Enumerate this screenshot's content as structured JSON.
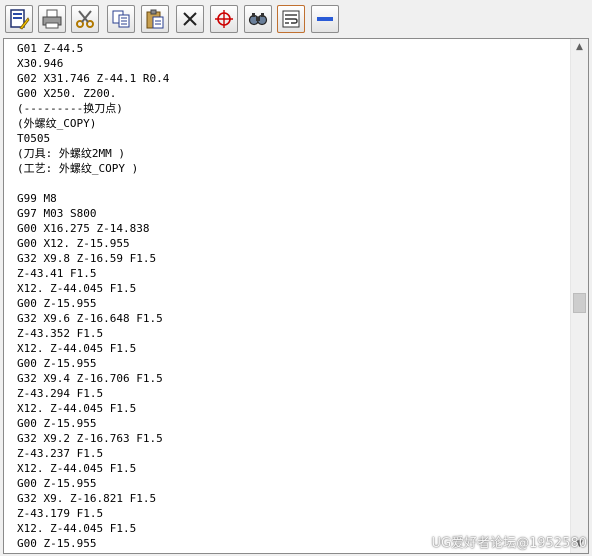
{
  "toolbar": {
    "buttons": [
      {
        "name": "edit-icon"
      },
      {
        "name": "print-icon"
      },
      {
        "name": "cut-icon"
      },
      {
        "name": "copy-icon"
      },
      {
        "name": "paste-icon"
      },
      {
        "name": "delete-icon"
      },
      {
        "name": "target-icon"
      },
      {
        "name": "find-icon"
      },
      {
        "name": "wrap-icon"
      },
      {
        "name": "minus-icon"
      }
    ]
  },
  "editor": {
    "lines": [
      "G01 Z-44.5",
      "X30.946",
      "G02 X31.746 Z-44.1 R0.4",
      "G00 X250. Z200.",
      "(---------换刀点)",
      "(外螺纹_COPY)",
      "T0505",
      "(刀具: 外螺纹2MM )",
      "(工艺: 外螺纹_COPY )",
      "",
      "G99 M8",
      "G97 M03 S800",
      "G00 X16.275 Z-14.838",
      "G00 X12. Z-15.955",
      "G32 X9.8 Z-16.59 F1.5",
      "Z-43.41 F1.5",
      "X12. Z-44.045 F1.5",
      "G00 Z-15.955",
      "G32 X9.6 Z-16.648 F1.5",
      "Z-43.352 F1.5",
      "X12. Z-44.045 F1.5",
      "G00 Z-15.955",
      "G32 X9.4 Z-16.706 F1.5",
      "Z-43.294 F1.5",
      "X12. Z-44.045 F1.5",
      "G00 Z-15.955",
      "G32 X9.2 Z-16.763 F1.5",
      "Z-43.237 F1.5",
      "X12. Z-44.045 F1.5",
      "G00 Z-15.955",
      "G32 X9. Z-16.821 F1.5",
      "Z-43.179 F1.5",
      "X12. Z-44.045 F1.5",
      "G00 Z-15.955"
    ]
  },
  "scrollbar": {
    "up_arrow": "▲",
    "down_arrow": "▼"
  },
  "watermark": "UG爱好者论坛@1952580"
}
